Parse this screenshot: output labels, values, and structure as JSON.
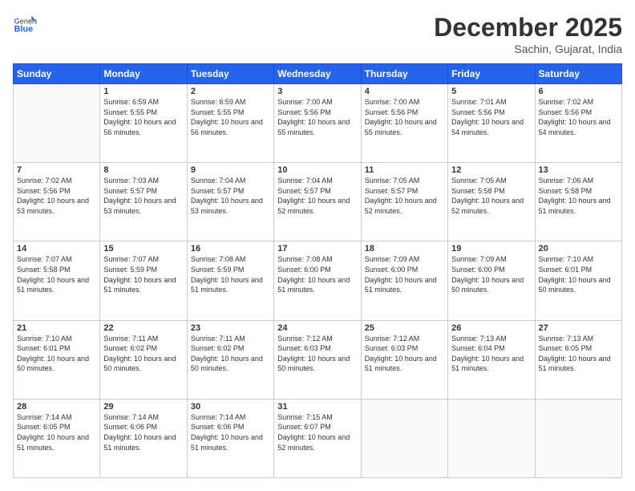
{
  "header": {
    "logo": {
      "general": "General",
      "blue": "Blue"
    },
    "title": "December 2025",
    "location": "Sachin, Gujarat, India"
  },
  "columns": [
    "Sunday",
    "Monday",
    "Tuesday",
    "Wednesday",
    "Thursday",
    "Friday",
    "Saturday"
  ],
  "weeks": [
    [
      {
        "day": "",
        "empty": true
      },
      {
        "day": "1",
        "sunrise": "6:59 AM",
        "sunset": "5:55 PM",
        "daylight": "10 hours and 56 minutes."
      },
      {
        "day": "2",
        "sunrise": "6:59 AM",
        "sunset": "5:55 PM",
        "daylight": "10 hours and 56 minutes."
      },
      {
        "day": "3",
        "sunrise": "7:00 AM",
        "sunset": "5:56 PM",
        "daylight": "10 hours and 55 minutes."
      },
      {
        "day": "4",
        "sunrise": "7:00 AM",
        "sunset": "5:56 PM",
        "daylight": "10 hours and 55 minutes."
      },
      {
        "day": "5",
        "sunrise": "7:01 AM",
        "sunset": "5:56 PM",
        "daylight": "10 hours and 54 minutes."
      },
      {
        "day": "6",
        "sunrise": "7:02 AM",
        "sunset": "5:56 PM",
        "daylight": "10 hours and 54 minutes."
      }
    ],
    [
      {
        "day": "7",
        "sunrise": "7:02 AM",
        "sunset": "5:56 PM",
        "daylight": "10 hours and 53 minutes."
      },
      {
        "day": "8",
        "sunrise": "7:03 AM",
        "sunset": "5:57 PM",
        "daylight": "10 hours and 53 minutes."
      },
      {
        "day": "9",
        "sunrise": "7:04 AM",
        "sunset": "5:57 PM",
        "daylight": "10 hours and 53 minutes."
      },
      {
        "day": "10",
        "sunrise": "7:04 AM",
        "sunset": "5:57 PM",
        "daylight": "10 hours and 52 minutes."
      },
      {
        "day": "11",
        "sunrise": "7:05 AM",
        "sunset": "5:57 PM",
        "daylight": "10 hours and 52 minutes."
      },
      {
        "day": "12",
        "sunrise": "7:05 AM",
        "sunset": "5:58 PM",
        "daylight": "10 hours and 52 minutes."
      },
      {
        "day": "13",
        "sunrise": "7:06 AM",
        "sunset": "5:58 PM",
        "daylight": "10 hours and 51 minutes."
      }
    ],
    [
      {
        "day": "14",
        "sunrise": "7:07 AM",
        "sunset": "5:58 PM",
        "daylight": "10 hours and 51 minutes."
      },
      {
        "day": "15",
        "sunrise": "7:07 AM",
        "sunset": "5:59 PM",
        "daylight": "10 hours and 51 minutes."
      },
      {
        "day": "16",
        "sunrise": "7:08 AM",
        "sunset": "5:59 PM",
        "daylight": "10 hours and 51 minutes."
      },
      {
        "day": "17",
        "sunrise": "7:08 AM",
        "sunset": "6:00 PM",
        "daylight": "10 hours and 51 minutes."
      },
      {
        "day": "18",
        "sunrise": "7:09 AM",
        "sunset": "6:00 PM",
        "daylight": "10 hours and 51 minutes."
      },
      {
        "day": "19",
        "sunrise": "7:09 AM",
        "sunset": "6:00 PM",
        "daylight": "10 hours and 50 minutes."
      },
      {
        "day": "20",
        "sunrise": "7:10 AM",
        "sunset": "6:01 PM",
        "daylight": "10 hours and 50 minutes."
      }
    ],
    [
      {
        "day": "21",
        "sunrise": "7:10 AM",
        "sunset": "6:01 PM",
        "daylight": "10 hours and 50 minutes."
      },
      {
        "day": "22",
        "sunrise": "7:11 AM",
        "sunset": "6:02 PM",
        "daylight": "10 hours and 50 minutes."
      },
      {
        "day": "23",
        "sunrise": "7:11 AM",
        "sunset": "6:02 PM",
        "daylight": "10 hours and 50 minutes."
      },
      {
        "day": "24",
        "sunrise": "7:12 AM",
        "sunset": "6:03 PM",
        "daylight": "10 hours and 50 minutes."
      },
      {
        "day": "25",
        "sunrise": "7:12 AM",
        "sunset": "6:03 PM",
        "daylight": "10 hours and 51 minutes."
      },
      {
        "day": "26",
        "sunrise": "7:13 AM",
        "sunset": "6:04 PM",
        "daylight": "10 hours and 51 minutes."
      },
      {
        "day": "27",
        "sunrise": "7:13 AM",
        "sunset": "6:05 PM",
        "daylight": "10 hours and 51 minutes."
      }
    ],
    [
      {
        "day": "28",
        "sunrise": "7:14 AM",
        "sunset": "6:05 PM",
        "daylight": "10 hours and 51 minutes."
      },
      {
        "day": "29",
        "sunrise": "7:14 AM",
        "sunset": "6:06 PM",
        "daylight": "10 hours and 51 minutes."
      },
      {
        "day": "30",
        "sunrise": "7:14 AM",
        "sunset": "6:06 PM",
        "daylight": "10 hours and 51 minutes."
      },
      {
        "day": "31",
        "sunrise": "7:15 AM",
        "sunset": "6:07 PM",
        "daylight": "10 hours and 52 minutes."
      },
      {
        "day": "",
        "empty": true
      },
      {
        "day": "",
        "empty": true
      },
      {
        "day": "",
        "empty": true
      }
    ]
  ],
  "labels": {
    "sunrise": "Sunrise:",
    "sunset": "Sunset:",
    "daylight": "Daylight:"
  }
}
